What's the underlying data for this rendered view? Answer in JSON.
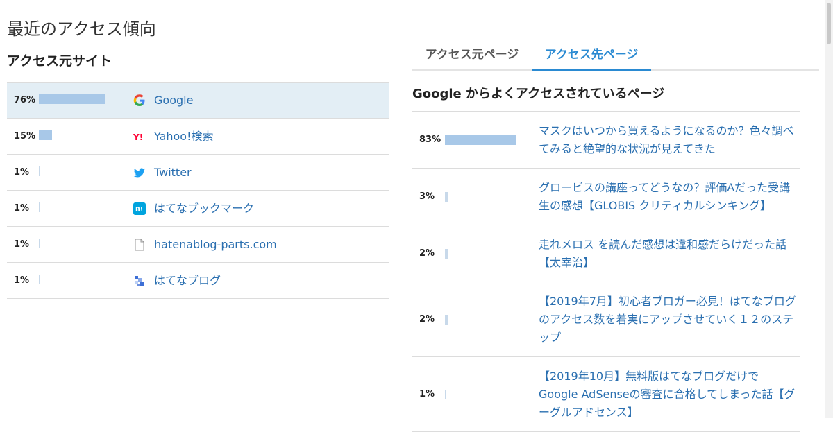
{
  "page_title": "最近のアクセス傾向",
  "sources": {
    "title": "アクセス元サイト",
    "items": [
      {
        "pct": "76%",
        "value": 76,
        "label": "Google",
        "icon": "google-icon"
      },
      {
        "pct": "15%",
        "value": 15,
        "label": "Yahoo!検索",
        "icon": "yahoo-icon"
      },
      {
        "pct": "1%",
        "value": 1,
        "label": "Twitter",
        "icon": "twitter-icon"
      },
      {
        "pct": "1%",
        "value": 1,
        "label": "はてなブックマーク",
        "icon": "hatena-bookmark-icon"
      },
      {
        "pct": "1%",
        "value": 1,
        "label": "hatenablog-parts.com",
        "icon": "page-icon"
      },
      {
        "pct": "1%",
        "value": 1,
        "label": "はてなブログ",
        "icon": "hatena-blog-icon"
      }
    ]
  },
  "tabs": {
    "source_pages": "アクセス元ページ",
    "dest_pages": "アクセス先ページ",
    "active": "dest_pages"
  },
  "destinations": {
    "title": "Google からよくアクセスされているページ",
    "items": [
      {
        "pct": "83%",
        "value": 83,
        "title": "マスクはいつから買えるようになるのか？色々調べてみると絶望的な状況が見えてきた"
      },
      {
        "pct": "3%",
        "value": 3,
        "title": "グロービスの講座ってどうなの？評価Aだった受講生の感想【GLOBIS クリティカルシンキング】"
      },
      {
        "pct": "2%",
        "value": 2,
        "title": "走れメロス を読んだ感想は違和感だらけだった話【太宰治】"
      },
      {
        "pct": "2%",
        "value": 2,
        "title": "【2019年7月】初心者ブロガー必見！はてなブログのアクセス数を着実にアップさせていく１２のステップ"
      },
      {
        "pct": "1%",
        "value": 1,
        "title": "【2019年10月】無料版はてなブログだけでGoogle AdSenseの審査に合格してしまった話【グーグルアドセンス】"
      }
    ]
  },
  "colors": {
    "bar": "#a8c8e8",
    "link": "#2a6fb0",
    "active_tab": "#2a8ad2",
    "active_row": "#e3eef5"
  }
}
